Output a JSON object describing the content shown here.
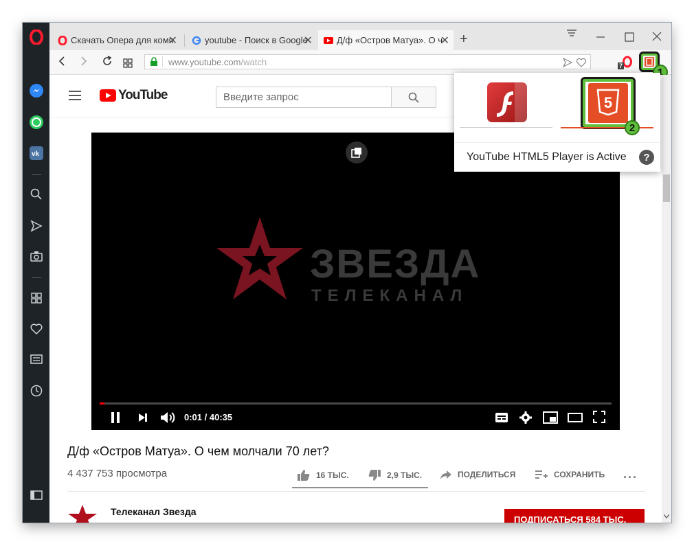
{
  "tabs": [
    {
      "title": "Скачать Опера для компь",
      "icon": "opera-icon",
      "active": false
    },
    {
      "title": "youtube - Поиск в Google",
      "icon": "google-icon",
      "active": false
    },
    {
      "title": "Д/ф «Остров Матуа». О че",
      "icon": "youtube-tab-icon",
      "active": true
    }
  ],
  "address": {
    "url_host": "www.youtube.com",
    "url_path": "/watch"
  },
  "extension_badge": "7",
  "youtube": {
    "logo_text": "YouTube",
    "search_placeholder": "Введите запрос",
    "player": {
      "time": "0:01 / 40:35",
      "channel_watermark": "ЗВЕЗДА",
      "channel_sub": "ТЕЛЕКАНАЛ",
      "progress": 0.01
    },
    "video_title": "Д/ф «Остров Матуа». О чем молчали 70 лет?",
    "views": "4 437 753 просмотра",
    "actions": {
      "likes": "16 ТЫС.",
      "dislikes": "2,9 ТЫС.",
      "share": "ПОДЕЛИТЬСЯ",
      "save": "СОХРАНИТЬ"
    },
    "channel_name": "Телеканал Звезда",
    "subscribe": "ПОДПИСАТЬСЯ  584 ТЫС."
  },
  "popup": {
    "status": "YouTube HTML5 Player is Active",
    "html5_label": "5"
  },
  "callouts": [
    "1",
    "2"
  ],
  "colors": {
    "youtube_red": "#ff0000",
    "flash_red": "#d32a2a",
    "html5_orange": "#e44d26",
    "callout_green": "#5fbf3c",
    "opera_red": "#ff1b2d"
  }
}
